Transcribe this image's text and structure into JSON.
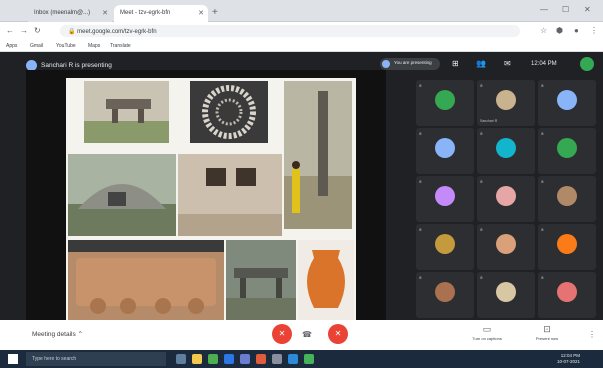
{
  "browser": {
    "tabs": [
      {
        "title": "Inbox (meenalm@...)"
      },
      {
        "title": "Meet - tzv-egrk-bfn"
      }
    ],
    "new_tab_label": "+",
    "url": "meet.google.com/tzv-egrk-bfn",
    "bookmarks": [
      "Apps",
      "Gmail",
      "YouTube",
      "Maps",
      "Translate"
    ]
  },
  "meet": {
    "presenting_text": "Sanchari R is presenting",
    "self_chip_text": "You are presenting",
    "clock": "12:04 PM",
    "meeting_details_label": "Meeting details",
    "controls": {
      "mic_label": "mic",
      "hangup_label": "end call",
      "camera_label": "camera",
      "present_label": "Turn on captions",
      "present_now_label": "Present now"
    },
    "participants": [
      {
        "name": "",
        "color": "#34a853"
      },
      {
        "name": "Sanchari R",
        "color": "#c9b28e"
      },
      {
        "name": "",
        "color": "#8ab4f8"
      },
      {
        "name": "",
        "color": "#8ab4f8"
      },
      {
        "name": "",
        "color": "#12b5cb"
      },
      {
        "name": "",
        "color": "#34a853"
      },
      {
        "name": "",
        "color": "#c58af9"
      },
      {
        "name": "",
        "color": "#e6a6a6"
      },
      {
        "name": "",
        "color": "#b08968"
      },
      {
        "name": "",
        "color": "#c49a3c"
      },
      {
        "name": "",
        "color": "#d9a07a"
      },
      {
        "name": "",
        "color": "#fa7b17"
      },
      {
        "name": "",
        "color": "#a9714f"
      },
      {
        "name": "",
        "color": "#d8c7a3"
      },
      {
        "name": "",
        "color": "#e57373"
      }
    ]
  },
  "taskbar": {
    "search_placeholder": "Type here to search",
    "time": "12:04 PM",
    "date": "10-07-2021"
  },
  "colors": {
    "meet_bg": "#202124",
    "hangup_red": "#ea4335",
    "taskbar": "#1b2b3d"
  }
}
